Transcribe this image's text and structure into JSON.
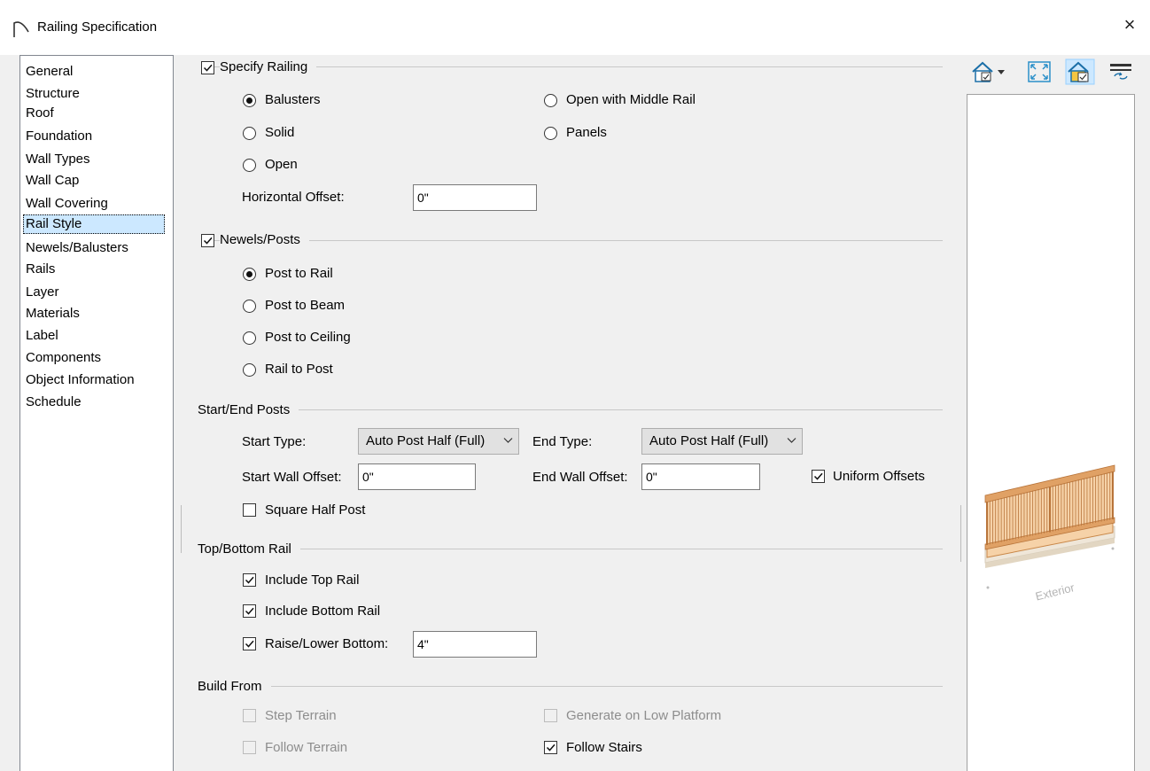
{
  "window": {
    "title": "Railing Specification",
    "close": "×"
  },
  "sidebar": {
    "items": [
      {
        "label": "General"
      },
      {
        "label": "Structure"
      },
      {
        "label": "Roof"
      },
      {
        "label": "Foundation"
      },
      {
        "label": "Wall Types"
      },
      {
        "label": "Wall Cap"
      },
      {
        "label": "Wall Covering"
      },
      {
        "label": "Rail Style",
        "selected": true
      },
      {
        "label": "Newels/Balusters"
      },
      {
        "label": "Rails"
      },
      {
        "label": "Layer"
      },
      {
        "label": "Materials"
      },
      {
        "label": "Label"
      },
      {
        "label": "Components"
      },
      {
        "label": "Object Information"
      },
      {
        "label": "Schedule"
      }
    ]
  },
  "specify_railing": {
    "label": "Specify Railing",
    "checked": true,
    "options": {
      "balusters": "Balusters",
      "solid": "Solid",
      "open": "Open",
      "open_middle": "Open with Middle Rail",
      "panels": "Panels"
    },
    "selected": "Balusters",
    "horizontal_offset_label": "Horizontal Offset:",
    "horizontal_offset_value": "0\""
  },
  "newels_posts": {
    "label": "Newels/Posts",
    "checked": true,
    "options": {
      "post_to_rail": "Post to Rail",
      "post_to_beam": "Post to Beam",
      "post_to_ceiling": "Post to Ceiling",
      "rail_to_post": "Rail to Post"
    },
    "selected": "Post to Rail"
  },
  "start_end_posts": {
    "label": "Start/End Posts",
    "start_type_label": "Start Type:",
    "start_type_value": "Auto Post Half (Full)",
    "end_type_label": "End Type:",
    "end_type_value": "Auto Post Half (Full)",
    "start_wall_offset_label": "Start Wall Offset:",
    "start_wall_offset_value": "0\"",
    "end_wall_offset_label": "End Wall Offset:",
    "end_wall_offset_value": "0\"",
    "uniform_offsets_label": "Uniform Offsets",
    "uniform_offsets_checked": true,
    "square_half_post_label": "Square Half Post",
    "square_half_post_checked": false
  },
  "top_bottom_rail": {
    "label": "Top/Bottom Rail",
    "include_top_label": "Include Top Rail",
    "include_top_checked": true,
    "include_bottom_label": "Include Bottom Rail",
    "include_bottom_checked": true,
    "raise_lower_label": "Raise/Lower Bottom:",
    "raise_lower_checked": true,
    "raise_lower_value": "4\""
  },
  "build_from": {
    "label": "Build From",
    "step_terrain_label": "Step Terrain",
    "step_terrain_checked": false,
    "follow_terrain_label": "Follow Terrain",
    "follow_terrain_checked": false,
    "generate_low_platform_label": "Generate on Low Platform",
    "generate_low_platform_checked": false,
    "follow_stairs_label": "Follow Stairs",
    "follow_stairs_checked": true
  },
  "preview": {
    "label": "Exterior",
    "toolbar": [
      "camera-view-icon",
      "fit-view-icon",
      "show-house-icon",
      "swap-side-icon"
    ],
    "colors": {
      "railing": "#e0a165",
      "railing_dark": "#b8743a",
      "base": "#efe6d8"
    }
  }
}
